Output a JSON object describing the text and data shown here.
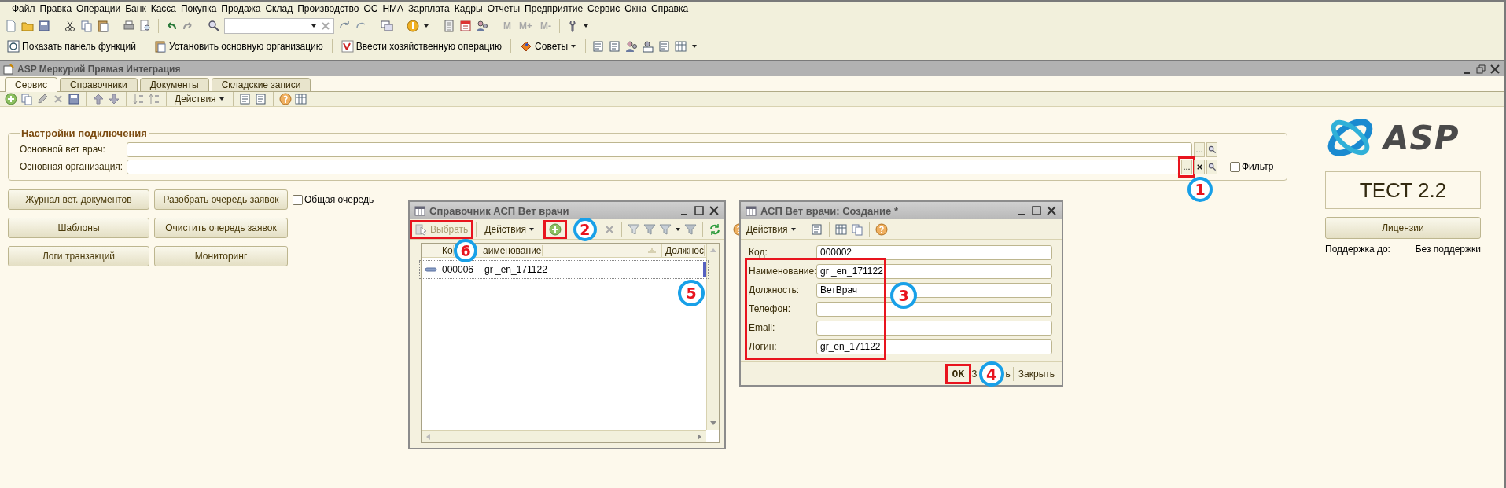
{
  "menu": [
    "Файл",
    "Правка",
    "Операции",
    "Банк",
    "Касса",
    "Покупка",
    "Продажа",
    "Склад",
    "Производство",
    "ОС",
    "НМА",
    "Зарплата",
    "Кадры",
    "Отчеты",
    "Предприятие",
    "Сервис",
    "Окна",
    "Справка"
  ],
  "toolbar": {
    "memory_buttons": [
      "M",
      "M+",
      "M-"
    ]
  },
  "panel_toolbar": {
    "buttons": [
      "Показать панель функций",
      "Установить основную организацию",
      "Ввести хозяйственную операцию",
      "Советы"
    ]
  },
  "window": {
    "title": "ASP Меркурий Прямая Интеграция",
    "tabs": [
      {
        "label": "Сервис",
        "selected": true
      },
      {
        "label": "Справочники",
        "selected": false
      },
      {
        "label": "Документы",
        "selected": false
      },
      {
        "label": "Складские записи",
        "selected": false
      }
    ],
    "actions_menu": "Действия",
    "settings": {
      "title": "Настройки подключения",
      "fields": [
        {
          "label": "Основной вет врач:",
          "choose_button": "...",
          "clear_button": false
        },
        {
          "label": "Основная организация:",
          "choose_button": "...",
          "clear_button": true
        }
      ],
      "filter": {
        "label": "Фильтр",
        "checked": false
      }
    },
    "buttons_left": [
      "Журнал вет. документов",
      "Шаблоны",
      "Логи транзакций"
    ],
    "buttons_right": [
      "Разобрать очередь заявок",
      "Очистить очередь заявок",
      "Мониторинг"
    ],
    "queue_checkbox": {
      "label": "Общая очередь",
      "checked": false
    },
    "brand": {
      "logo_text": "ASP",
      "version": "ТЕСТ 2.2",
      "license_button": "Лицензии",
      "support_label": "Поддержка до:",
      "support_value": "Без поддержки"
    }
  },
  "catalog_dialog": {
    "title": "Справочник АСП Вет врачи",
    "select_button": {
      "label": "Выбрать",
      "disabled": true
    },
    "actions_menu": "Действия",
    "columns": [
      "Ко",
      "аименование",
      "Должнос"
    ],
    "rows": [
      {
        "code": "000006",
        "name": "gr _en_171122",
        "selected": true
      }
    ]
  },
  "edit_dialog": {
    "title": "АСП Вет врачи: Создание *",
    "actions_menu": "Действия",
    "fields": [
      {
        "label": "Код:",
        "value": "000002"
      },
      {
        "label": "Наименование:",
        "value": "gr _en_171122"
      },
      {
        "label": "Должность:",
        "value": "ВетВрач"
      },
      {
        "label": "Телефон:"
      },
      {
        "label": "Email:"
      },
      {
        "label": "Логин:",
        "value": "gr_en_171122"
      }
    ],
    "ok_button": "OK",
    "save_button_parts": [
      "З",
      "ь"
    ],
    "close_button": "Закрыть"
  },
  "annotations": [
    {
      "number": "1"
    },
    {
      "number": "2"
    },
    {
      "number": "3"
    },
    {
      "number": "4"
    },
    {
      "number": "5"
    },
    {
      "number": "6"
    }
  ]
}
